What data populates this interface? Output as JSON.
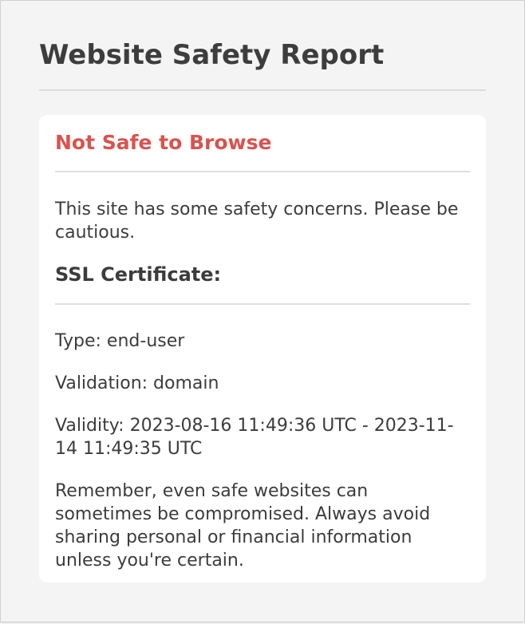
{
  "popup": {
    "title": "Website Safety Report"
  },
  "report": {
    "status": "Not Safe to Browse",
    "status_color": "#d9534f",
    "message": "This site has some safety concerns. Please be cautious.",
    "ssl": {
      "heading": "SSL Certificate:",
      "type": "Type: end-user",
      "validation": "Validation: domain",
      "validity": "Validity: 2023-08-16 11:49:36 UTC - 2023-11-14 11:49:35 UTC"
    },
    "reminder": "Remember, even safe websites can sometimes be compromised. Always avoid sharing personal or financial information unless you're certain."
  }
}
